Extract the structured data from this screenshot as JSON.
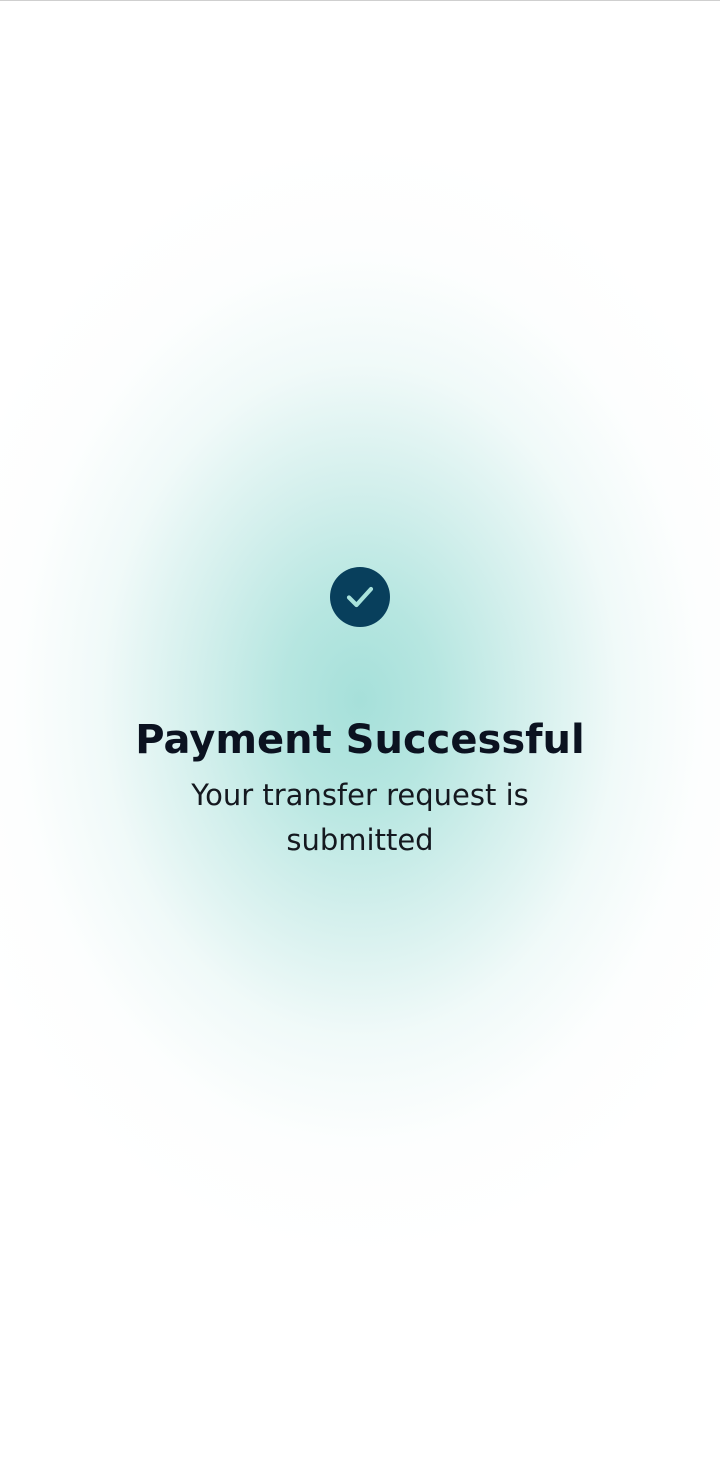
{
  "screen": {
    "title": "Payment Successful",
    "message": "Your transfer request is submitted"
  },
  "icons": {
    "status": "check-circle-icon"
  },
  "colors": {
    "icon_background": "#083f5c",
    "icon_check": "#a9e3dc",
    "glow": "#a6e0da",
    "text": "#0b1220"
  }
}
